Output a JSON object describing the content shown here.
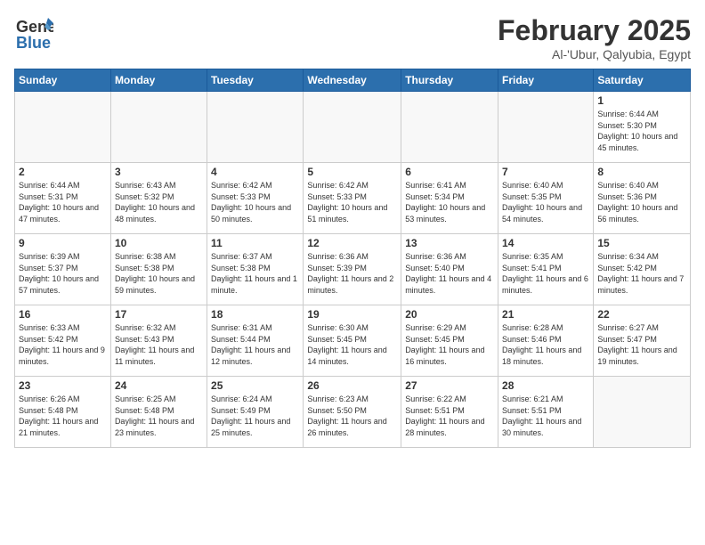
{
  "header": {
    "logo_general": "General",
    "logo_blue": "Blue",
    "month_title": "February 2025",
    "location": "Al-'Ubur, Qalyubia, Egypt"
  },
  "days_of_week": [
    "Sunday",
    "Monday",
    "Tuesday",
    "Wednesday",
    "Thursday",
    "Friday",
    "Saturday"
  ],
  "weeks": [
    [
      {
        "day": "",
        "info": ""
      },
      {
        "day": "",
        "info": ""
      },
      {
        "day": "",
        "info": ""
      },
      {
        "day": "",
        "info": ""
      },
      {
        "day": "",
        "info": ""
      },
      {
        "day": "",
        "info": ""
      },
      {
        "day": "1",
        "info": "Sunrise: 6:44 AM\nSunset: 5:30 PM\nDaylight: 10 hours and 45 minutes."
      }
    ],
    [
      {
        "day": "2",
        "info": "Sunrise: 6:44 AM\nSunset: 5:31 PM\nDaylight: 10 hours and 47 minutes."
      },
      {
        "day": "3",
        "info": "Sunrise: 6:43 AM\nSunset: 5:32 PM\nDaylight: 10 hours and 48 minutes."
      },
      {
        "day": "4",
        "info": "Sunrise: 6:42 AM\nSunset: 5:33 PM\nDaylight: 10 hours and 50 minutes."
      },
      {
        "day": "5",
        "info": "Sunrise: 6:42 AM\nSunset: 5:33 PM\nDaylight: 10 hours and 51 minutes."
      },
      {
        "day": "6",
        "info": "Sunrise: 6:41 AM\nSunset: 5:34 PM\nDaylight: 10 hours and 53 minutes."
      },
      {
        "day": "7",
        "info": "Sunrise: 6:40 AM\nSunset: 5:35 PM\nDaylight: 10 hours and 54 minutes."
      },
      {
        "day": "8",
        "info": "Sunrise: 6:40 AM\nSunset: 5:36 PM\nDaylight: 10 hours and 56 minutes."
      }
    ],
    [
      {
        "day": "9",
        "info": "Sunrise: 6:39 AM\nSunset: 5:37 PM\nDaylight: 10 hours and 57 minutes."
      },
      {
        "day": "10",
        "info": "Sunrise: 6:38 AM\nSunset: 5:38 PM\nDaylight: 10 hours and 59 minutes."
      },
      {
        "day": "11",
        "info": "Sunrise: 6:37 AM\nSunset: 5:38 PM\nDaylight: 11 hours and 1 minute."
      },
      {
        "day": "12",
        "info": "Sunrise: 6:36 AM\nSunset: 5:39 PM\nDaylight: 11 hours and 2 minutes."
      },
      {
        "day": "13",
        "info": "Sunrise: 6:36 AM\nSunset: 5:40 PM\nDaylight: 11 hours and 4 minutes."
      },
      {
        "day": "14",
        "info": "Sunrise: 6:35 AM\nSunset: 5:41 PM\nDaylight: 11 hours and 6 minutes."
      },
      {
        "day": "15",
        "info": "Sunrise: 6:34 AM\nSunset: 5:42 PM\nDaylight: 11 hours and 7 minutes."
      }
    ],
    [
      {
        "day": "16",
        "info": "Sunrise: 6:33 AM\nSunset: 5:42 PM\nDaylight: 11 hours and 9 minutes."
      },
      {
        "day": "17",
        "info": "Sunrise: 6:32 AM\nSunset: 5:43 PM\nDaylight: 11 hours and 11 minutes."
      },
      {
        "day": "18",
        "info": "Sunrise: 6:31 AM\nSunset: 5:44 PM\nDaylight: 11 hours and 12 minutes."
      },
      {
        "day": "19",
        "info": "Sunrise: 6:30 AM\nSunset: 5:45 PM\nDaylight: 11 hours and 14 minutes."
      },
      {
        "day": "20",
        "info": "Sunrise: 6:29 AM\nSunset: 5:45 PM\nDaylight: 11 hours and 16 minutes."
      },
      {
        "day": "21",
        "info": "Sunrise: 6:28 AM\nSunset: 5:46 PM\nDaylight: 11 hours and 18 minutes."
      },
      {
        "day": "22",
        "info": "Sunrise: 6:27 AM\nSunset: 5:47 PM\nDaylight: 11 hours and 19 minutes."
      }
    ],
    [
      {
        "day": "23",
        "info": "Sunrise: 6:26 AM\nSunset: 5:48 PM\nDaylight: 11 hours and 21 minutes."
      },
      {
        "day": "24",
        "info": "Sunrise: 6:25 AM\nSunset: 5:48 PM\nDaylight: 11 hours and 23 minutes."
      },
      {
        "day": "25",
        "info": "Sunrise: 6:24 AM\nSunset: 5:49 PM\nDaylight: 11 hours and 25 minutes."
      },
      {
        "day": "26",
        "info": "Sunrise: 6:23 AM\nSunset: 5:50 PM\nDaylight: 11 hours and 26 minutes."
      },
      {
        "day": "27",
        "info": "Sunrise: 6:22 AM\nSunset: 5:51 PM\nDaylight: 11 hours and 28 minutes."
      },
      {
        "day": "28",
        "info": "Sunrise: 6:21 AM\nSunset: 5:51 PM\nDaylight: 11 hours and 30 minutes."
      },
      {
        "day": "",
        "info": ""
      }
    ]
  ]
}
